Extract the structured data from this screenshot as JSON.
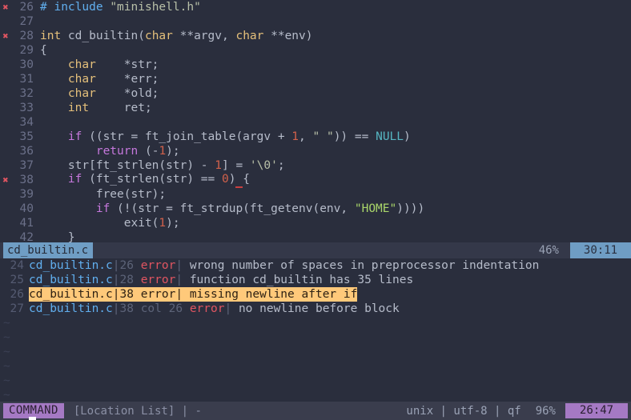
{
  "editor": {
    "lines": [
      {
        "num": "26",
        "sign": "✖",
        "tokens": [
          {
            "cls": "t-pre",
            "text": "# include "
          },
          {
            "cls": "t-str2",
            "text": "\"minishell.h\""
          }
        ]
      },
      {
        "num": "27",
        "sign": "",
        "tokens": []
      },
      {
        "num": "28",
        "sign": "✖",
        "tokens": [
          {
            "cls": "t-type",
            "text": "int"
          },
          {
            "cls": "t-plain",
            "text": " cd_builtin("
          },
          {
            "cls": "t-type",
            "text": "char"
          },
          {
            "cls": "t-plain",
            "text": " **argv, "
          },
          {
            "cls": "t-type",
            "text": "char"
          },
          {
            "cls": "t-plain",
            "text": " **env)"
          }
        ]
      },
      {
        "num": "29",
        "sign": "",
        "tokens": [
          {
            "cls": "t-plain",
            "text": "{"
          }
        ]
      },
      {
        "num": "30",
        "sign": "",
        "tokens": [
          {
            "cls": "t-plain",
            "text": "    "
          },
          {
            "cls": "t-type",
            "text": "char"
          },
          {
            "cls": "t-plain",
            "text": "    *str;"
          }
        ]
      },
      {
        "num": "31",
        "sign": "",
        "tokens": [
          {
            "cls": "t-plain",
            "text": "    "
          },
          {
            "cls": "t-type",
            "text": "char"
          },
          {
            "cls": "t-plain",
            "text": "    *err;"
          }
        ]
      },
      {
        "num": "32",
        "sign": "",
        "tokens": [
          {
            "cls": "t-plain",
            "text": "    "
          },
          {
            "cls": "t-type",
            "text": "char"
          },
          {
            "cls": "t-plain",
            "text": "    *old;"
          }
        ]
      },
      {
        "num": "33",
        "sign": "",
        "tokens": [
          {
            "cls": "t-plain",
            "text": "    "
          },
          {
            "cls": "t-type",
            "text": "int"
          },
          {
            "cls": "t-plain",
            "text": "     ret;"
          }
        ]
      },
      {
        "num": "34",
        "sign": "",
        "tokens": []
      },
      {
        "num": "35",
        "sign": "",
        "tokens": [
          {
            "cls": "t-plain",
            "text": "    "
          },
          {
            "cls": "t-kw",
            "text": "if"
          },
          {
            "cls": "t-plain",
            "text": " ((str = ft_join_table(argv + "
          },
          {
            "cls": "t-num",
            "text": "1"
          },
          {
            "cls": "t-plain",
            "text": ", "
          },
          {
            "cls": "t-str2",
            "text": "\" \""
          },
          {
            "cls": "t-plain",
            "text": ")) == "
          },
          {
            "cls": "t-const",
            "text": "NULL"
          },
          {
            "cls": "t-plain",
            "text": ")"
          }
        ]
      },
      {
        "num": "36",
        "sign": "",
        "tokens": [
          {
            "cls": "t-plain",
            "text": "        "
          },
          {
            "cls": "t-kw",
            "text": "return"
          },
          {
            "cls": "t-plain",
            "text": " (-"
          },
          {
            "cls": "t-num",
            "text": "1"
          },
          {
            "cls": "t-plain",
            "text": ");"
          }
        ]
      },
      {
        "num": "37",
        "sign": "",
        "tokens": [
          {
            "cls": "t-plain",
            "text": "    str[ft_strlen(str) - "
          },
          {
            "cls": "t-num",
            "text": "1"
          },
          {
            "cls": "t-plain",
            "text": "] = "
          },
          {
            "cls": "t-str2",
            "text": "'\\0'"
          },
          {
            "cls": "t-plain",
            "text": ";"
          }
        ]
      },
      {
        "num": "38",
        "sign": "✖",
        "tokens": [
          {
            "cls": "t-plain",
            "text": "    "
          },
          {
            "cls": "t-kw",
            "text": "if"
          },
          {
            "cls": "t-plain",
            "text": " (ft_strlen(str) == "
          },
          {
            "cls": "t-num",
            "text": "0"
          },
          {
            "cls": "t-plain",
            "text": ")"
          },
          {
            "cls": "err-underline t-plain",
            "text": " "
          },
          {
            "cls": "t-plain",
            "text": "{"
          }
        ]
      },
      {
        "num": "39",
        "sign": "",
        "tokens": [
          {
            "cls": "t-plain",
            "text": "        free(str);"
          }
        ]
      },
      {
        "num": "40",
        "sign": "",
        "tokens": [
          {
            "cls": "t-plain",
            "text": "        "
          },
          {
            "cls": "t-kw",
            "text": "if"
          },
          {
            "cls": "t-plain",
            "text": " (!(str = ft_strdup(ft_getenv(env, "
          },
          {
            "cls": "t-str",
            "text": "\"HOME\""
          },
          {
            "cls": "t-plain",
            "text": "))))"
          }
        ]
      },
      {
        "num": "41",
        "sign": "",
        "tokens": [
          {
            "cls": "t-plain",
            "text": "            exit("
          },
          {
            "cls": "t-num",
            "text": "1"
          },
          {
            "cls": "t-plain",
            "text": ");"
          }
        ]
      },
      {
        "num": "42",
        "sign": "",
        "tokens": [
          {
            "cls": "t-plain",
            "text": "    }"
          }
        ]
      }
    ]
  },
  "editor_status": {
    "filename": "cd_builtin.c",
    "percent": "46%",
    "ruler": "30:11"
  },
  "quickfix": {
    "entries": [
      {
        "num": "24",
        "file": "cd_builtin.c",
        "sep1": "|",
        "line": "26",
        "col_label": "",
        "col": "",
        "level": "error",
        "sep2": "|",
        "message": "wrong number of spaces in preprocessor indentation",
        "selected": false
      },
      {
        "num": "25",
        "file": "cd_builtin.c",
        "sep1": "|",
        "line": "28",
        "col_label": "",
        "col": "",
        "level": "error",
        "sep2": "|",
        "message": "function cd_builtin has 35 lines",
        "selected": false
      },
      {
        "num": "26",
        "file": "cd_builtin.c",
        "sep1": "|",
        "line": "38",
        "col_label": "",
        "col": "",
        "level": "error",
        "sep2": "|",
        "message": "missing newline after if",
        "selected": true
      },
      {
        "num": "27",
        "file": "cd_builtin.c",
        "sep1": "|",
        "line": "38",
        "col_label": "col",
        "col": "26",
        "level": "error",
        "sep2": "|",
        "message": "no newline before block",
        "selected": false
      }
    ],
    "empty_marker": "~",
    "empty_rows": 6
  },
  "bottom_bar": {
    "mode": "COMMAND",
    "buffer_name": "[Location List] | -",
    "fileinfo": "unix | utf-8 | qf",
    "percent": "96%",
    "ruler": "26:47"
  },
  "colors": {
    "background": "#2a2e3d",
    "status_background": "#343849",
    "bottom_background": "#3a3d4d",
    "accent_blue": "#6f9dc4",
    "accent_purple": "#a579c4",
    "selection_amber": "#ffc97a",
    "error_red": "#e05561",
    "keyword_purple": "#c678dd",
    "type_yellow": "#e5c07b",
    "string_green": "#a9d66a",
    "number_orange": "#d1614b",
    "constant_cyan": "#56b6c2",
    "linenum_grey": "#6b7089"
  }
}
